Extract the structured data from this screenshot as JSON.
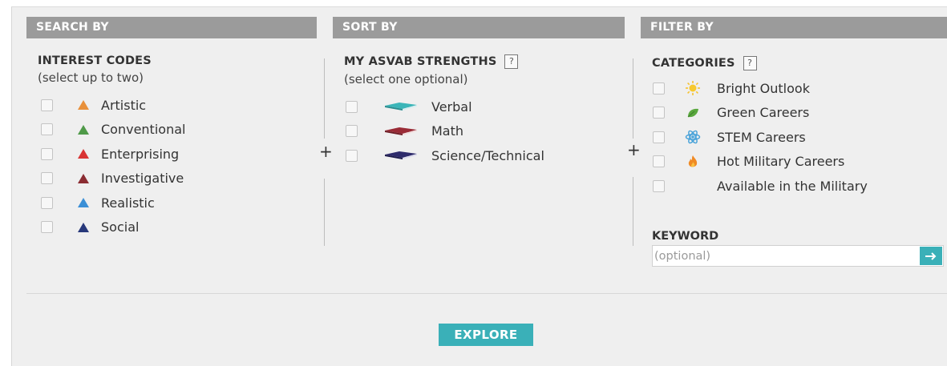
{
  "search": {
    "header": "SEARCH BY",
    "title": "INTEREST CODES",
    "subtitle": "(select up to two)",
    "options": [
      {
        "label": "Artistic",
        "color": "#e8903a"
      },
      {
        "label": "Conventional",
        "color": "#4f9a48"
      },
      {
        "label": "Enterprising",
        "color": "#d93434"
      },
      {
        "label": "Investigative",
        "color": "#8b2c32"
      },
      {
        "label": "Realistic",
        "color": "#3b8fd6"
      },
      {
        "label": "Social",
        "color": "#27387a"
      }
    ]
  },
  "sort": {
    "header": "SORT BY",
    "title": "MY ASVAB STRENGTHS",
    "help": "?",
    "subtitle": "(select one optional)",
    "options": [
      {
        "label": "Verbal",
        "icon": "book-teal-icon",
        "color": "#3bb5b8"
      },
      {
        "label": "Math",
        "icon": "book-red-icon",
        "color": "#9a2b36"
      },
      {
        "label": "Science/Technical",
        "icon": "book-navy-icon",
        "color": "#2e2b6b"
      }
    ]
  },
  "filter": {
    "header": "FILTER BY",
    "title": "CATEGORIES",
    "help": "?",
    "options": [
      {
        "label": "Bright Outlook",
        "icon": "sun-icon",
        "color": "#f5c230"
      },
      {
        "label": "Green Careers",
        "icon": "leaf-icon",
        "color": "#5aa83e"
      },
      {
        "label": "STEM Careers",
        "icon": "atom-icon",
        "color": "#4aa3d9"
      },
      {
        "label": "Hot Military Careers",
        "icon": "flame-icon",
        "color": "#f08a24"
      },
      {
        "label": "Available in the Military",
        "icon": "",
        "color": ""
      }
    ],
    "keyword_label": "KEYWORD",
    "keyword_placeholder": "(optional)",
    "keyword_value": ""
  },
  "separators": {
    "plus": "+"
  },
  "explore_label": "EXPLORE",
  "accent": "#3ab0b8"
}
